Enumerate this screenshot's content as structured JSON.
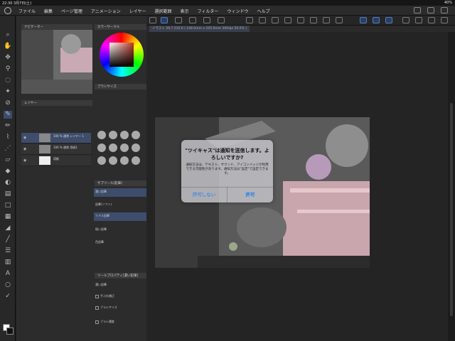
{
  "status_bar": {
    "time_date": "22:30 3月7日(土)",
    "battery": "40%"
  },
  "menu": [
    "ファイル",
    "編集",
    "ページ管理",
    "アニメーション",
    "レイヤー",
    "選択範囲",
    "表示",
    "フィルター",
    "ウィンドウ",
    "ヘルプ"
  ],
  "document_tab": "イラスト 29.7 210.0 ( 148.0mm x 105.0mm 300dpi 50.0% )",
  "panels": {
    "navigator": "ナビゲーター",
    "color": "カラーサークル",
    "brush": "ブラシサイズ",
    "layer": "レイヤー",
    "layers": [
      {
        "name": "100 % 通常\nレイヤー 1",
        "selected": true
      },
      {
        "name": "100 % 通常\n用紙1",
        "selected": false
      },
      {
        "name": "用紙",
        "selected": false
      }
    ],
    "subtool": "サブツール[鉛筆]",
    "subtools": [
      "濃い鉛筆",
      "鉛筆(ソフト)",
      "リアル鉛筆",
      "粗い鉛筆",
      "色鉛筆"
    ],
    "tool_property": "ツールプロパティ[濃い鉛筆]",
    "tool_property_items": [
      "濃い鉛筆",
      "手ぶれ補正",
      "ブラシサイズ",
      "ブラシ濃度"
    ]
  },
  "alert": {
    "title": "\"ツイキャス\"は通知を送信します。よろしいですか?",
    "message": "通知方法は、テキスト、サウンド、アイコンバッジが利用できる可能性があります。通知方法は\"設定\"で設定できます。",
    "deny": "許可しない",
    "allow": "許可"
  },
  "colors": {
    "accent": "#1a7cf0",
    "selection": "#3e4d6b"
  }
}
